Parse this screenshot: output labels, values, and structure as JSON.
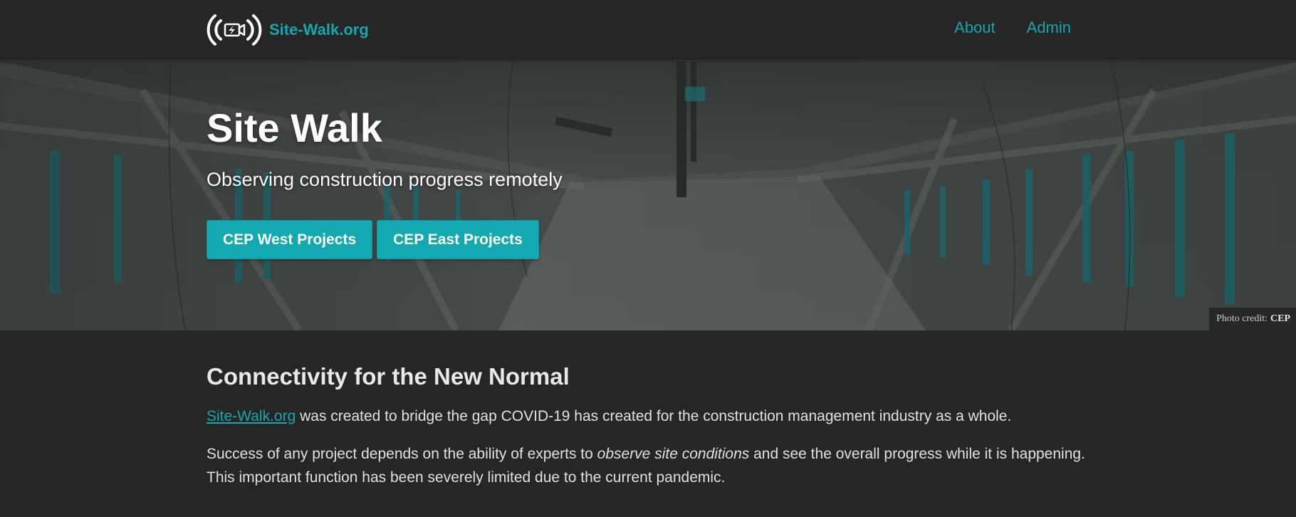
{
  "navbar": {
    "brand_text": "Site-Walk.org",
    "brand_logo_icon": "broadcast-camera-icon",
    "links": [
      {
        "label": "About"
      },
      {
        "label": "Admin"
      }
    ]
  },
  "hero": {
    "title": "Site Walk",
    "subtitle": "Observing construction progress remotely",
    "buttons": [
      {
        "label": "CEP West Projects"
      },
      {
        "label": "CEP East Projects"
      }
    ],
    "photo_credit_label": "Photo credit:",
    "photo_credit_name": "CEP"
  },
  "content": {
    "section_title": "Connectivity for the New Normal",
    "para1_link": "Site-Walk.org",
    "para1_rest": " was created to bridge the gap COVID-19 has created for the construction management industry as a whole.",
    "para2_before": "Success of any project depends on the ability of experts to ",
    "para2_em": "observe site conditions",
    "para2_after": " and see the overall progress while it is happening. This important function has been severely limited due to the current pandemic."
  },
  "colors": {
    "accent": "#17a6ad",
    "button": "#12a9b0",
    "background": "#262626"
  }
}
